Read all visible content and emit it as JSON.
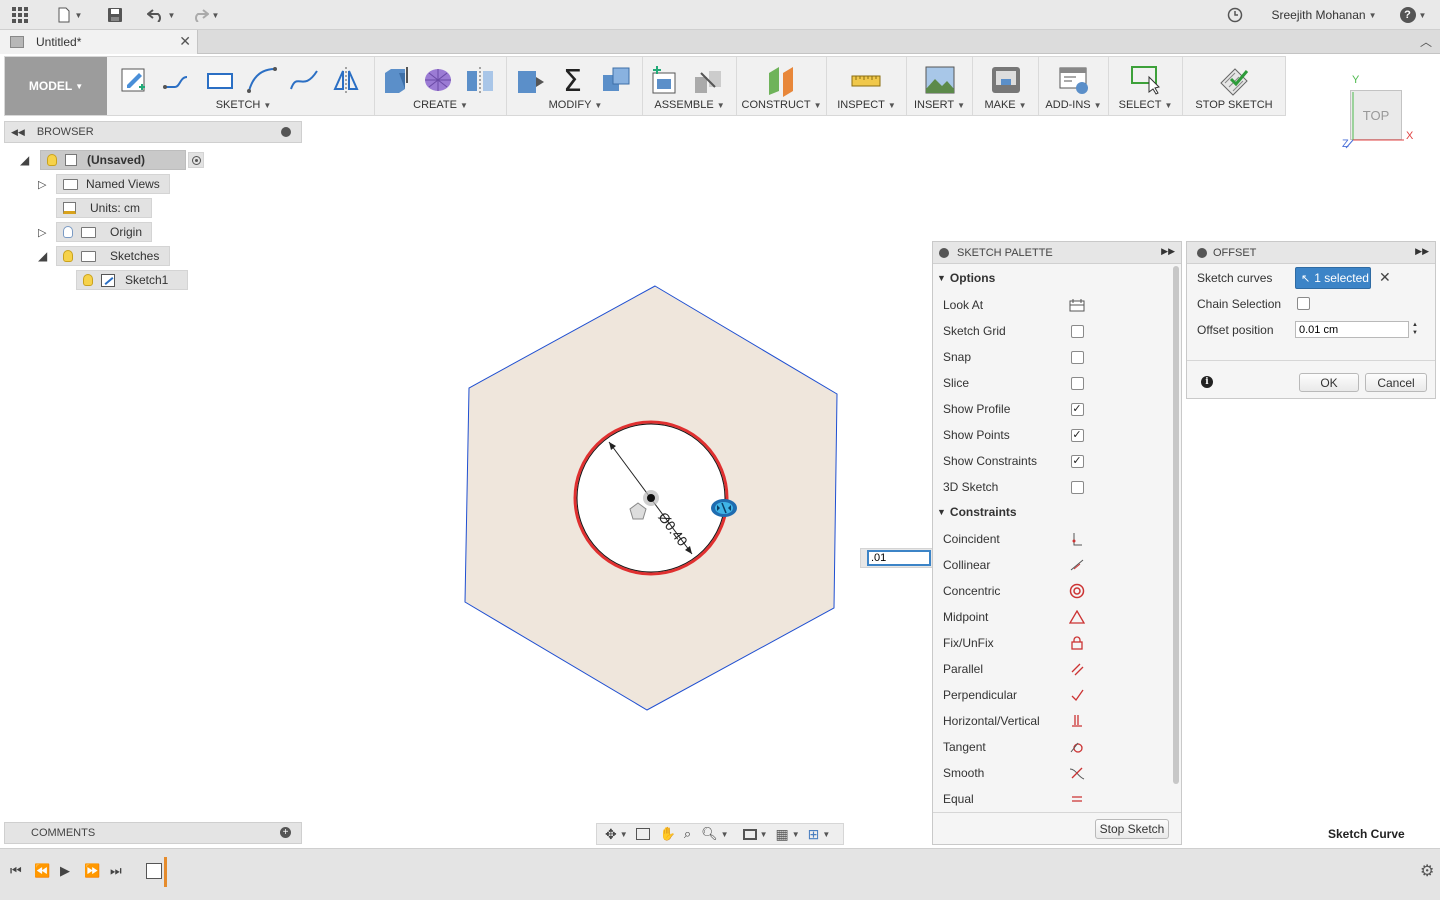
{
  "appbar": {
    "user_name": "Sreejith Mohanan",
    "help_label": "?"
  },
  "tab": {
    "title": "Untitled*"
  },
  "ribbon": {
    "model_label": "MODEL",
    "groups": {
      "sketch": "SKETCH",
      "create": "CREATE",
      "modify": "MODIFY",
      "assemble": "ASSEMBLE",
      "construct": "CONSTRUCT",
      "inspect": "INSPECT",
      "insert": "INSERT",
      "make": "MAKE",
      "addins": "ADD-INS",
      "select": "SELECT",
      "stop_sketch": "STOP SKETCH"
    }
  },
  "viewcube": {
    "face": "TOP",
    "axis_x": "X",
    "axis_y": "Y",
    "axis_z": "Z"
  },
  "browser": {
    "title": "BROWSER",
    "items": [
      {
        "label": "(Unsaved)"
      },
      {
        "label": "Named Views"
      },
      {
        "label": "Units: cm"
      },
      {
        "label": "Origin"
      },
      {
        "label": "Sketches"
      },
      {
        "label": "Sketch1"
      }
    ]
  },
  "canvas": {
    "dimension_label": "Ø0.40",
    "offset_input_value": ".01"
  },
  "palette": {
    "title": "SKETCH PALETTE",
    "options_title": "Options",
    "options": [
      {
        "label": "Look At",
        "checked": null
      },
      {
        "label": "Sketch Grid",
        "checked": false
      },
      {
        "label": "Snap",
        "checked": false
      },
      {
        "label": "Slice",
        "checked": false
      },
      {
        "label": "Show Profile",
        "checked": true
      },
      {
        "label": "Show Points",
        "checked": true
      },
      {
        "label": "Show Constraints",
        "checked": true
      },
      {
        "label": "3D Sketch",
        "checked": false
      }
    ],
    "constraints_title": "Constraints",
    "constraints": [
      {
        "label": "Coincident"
      },
      {
        "label": "Collinear"
      },
      {
        "label": "Concentric"
      },
      {
        "label": "Midpoint"
      },
      {
        "label": "Fix/UnFix"
      },
      {
        "label": "Parallel"
      },
      {
        "label": "Perpendicular"
      },
      {
        "label": "Horizontal/Vertical"
      },
      {
        "label": "Tangent"
      },
      {
        "label": "Smooth"
      },
      {
        "label": "Equal"
      }
    ],
    "stop_button": "Stop Sketch"
  },
  "offset": {
    "title": "OFFSET",
    "sketch_curves_label": "Sketch curves",
    "selected_text": "1 selected",
    "chain_label": "Chain Selection",
    "position_label": "Offset position",
    "position_value": "0.01 cm",
    "ok": "OK",
    "cancel": "Cancel"
  },
  "comments": {
    "title": "COMMENTS"
  },
  "status": {
    "text": "Sketch Curve"
  },
  "colors": {
    "accent": "#3c84c7",
    "profile_fill": "#efe6dc",
    "hex_edge": "#1f4fd1",
    "selected_curve": "#e03030"
  }
}
